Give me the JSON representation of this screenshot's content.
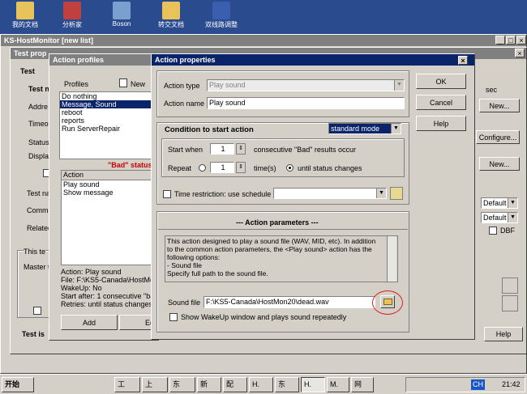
{
  "desktop": {
    "icons": [
      "我的文档",
      "分析家",
      "Boson",
      "转交文档",
      "双线路调整"
    ]
  },
  "main_window": {
    "title": "KS-HostMonitor  [new list]"
  },
  "test_props": {
    "title": "Test prop",
    "labels": {
      "test": "Test",
      "test_name_partial": "Test n",
      "address": "Addre",
      "timeout": "Timeo",
      "status": "Status",
      "display": "Displa",
      "test_name": "Test na",
      "comment": "Comme",
      "related": "Related",
      "this_test": "This te",
      "master": "Master t",
      "test_is": "Test is"
    },
    "sec_label": "sec",
    "new1": "New...",
    "configure": "Configure...",
    "new2": "New...",
    "default1": "Default",
    "default2": "Default",
    "dbf": "DBF",
    "help": "Help"
  },
  "action_profiles": {
    "title": "Action profiles",
    "profiles_label": "Profiles",
    "new_label": "New",
    "profiles": [
      "Do nothing",
      "Message, Sound",
      "reboot",
      "reports",
      "Run ServerRepair"
    ],
    "bad_status": "\"Bad\" status",
    "action_header": "Action",
    "actions": [
      "Play sound",
      "Show message"
    ],
    "details": [
      "Action: Play sound",
      "File: F:\\KS5-Canada\\HostMo",
      "WakeUp: No",
      "Start after: 1 consecutive \"ba",
      "Retries: until status changes"
    ],
    "add_button": "Add",
    "edit_button": "Edi"
  },
  "action_props": {
    "title": "Action properties",
    "ok": "OK",
    "cancel": "Cancel",
    "help": "Help",
    "action_type_label": "Action type",
    "action_type_value": "Play sound",
    "action_name_label": "Action name",
    "action_name_value": "Play sound",
    "condition_title": "Condition to start action",
    "mode_value": "standard mode",
    "start_when_label": "Start when",
    "start_when_value": "1",
    "start_when_suffix": "consecutive \"Bad\" results occur",
    "repeat_label": "Repeat",
    "repeat_value": "1",
    "repeat_suffix": "time(s)",
    "until_label": "until status changes",
    "time_restriction_label": "Time restriction: use schedule",
    "params_title": "--- Action parameters ---",
    "description": [
      "This action designed to play a sound file (WAV, MID, etc). In addition",
      "to the common action parameters, the <Play sound> action has the",
      "following options:",
      "- Sound file",
      "Specify full path to the sound file."
    ],
    "sound_file_label": "Sound file",
    "sound_file_value": "F:\\KS5-Canada\\HostMon20\\dead.wav",
    "wakeup_label": "Show WakeUp window and plays sound repeatedly"
  },
  "taskbar": {
    "start": "开始",
    "buttons": [
      "工",
      "上",
      "东",
      "新",
      "配",
      "H.",
      "东",
      "H.",
      "M.",
      "网"
    ],
    "lang": "CH",
    "time": "21:42"
  },
  "colors": {
    "desktop": "#2b4b8f",
    "active_title": "#0a246a",
    "face": "#d4d0c8",
    "bad_status": "#cc0000",
    "highlight_circle": "#e02020"
  }
}
